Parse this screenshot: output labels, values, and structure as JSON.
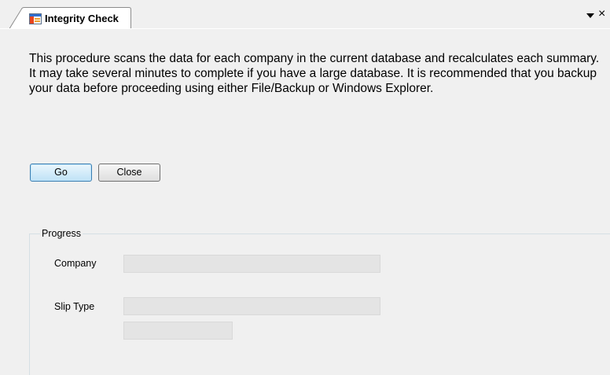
{
  "tab": {
    "title": "Integrity Check",
    "icon": "window-form-icon",
    "menu_icon": "chevron-down-icon",
    "close_glyph": "×"
  },
  "description": "This procedure scans the data for each company in the current database and recalculates each summary. It may take several minutes to complete if you have a large database. It is recommended that you backup your data before proceeding using either File/Backup or Windows Explorer.",
  "buttons": {
    "go": "Go",
    "close": "Close"
  },
  "progress": {
    "legend": "Progress",
    "company_label": "Company",
    "company_value": "",
    "slip_type_label": "Slip Type",
    "slip_type_value": "",
    "count_value": ""
  },
  "colors": {
    "background": "#f0f0f0",
    "field_fill": "#e4e4e4",
    "default_button_border": "#3c7fb1"
  }
}
